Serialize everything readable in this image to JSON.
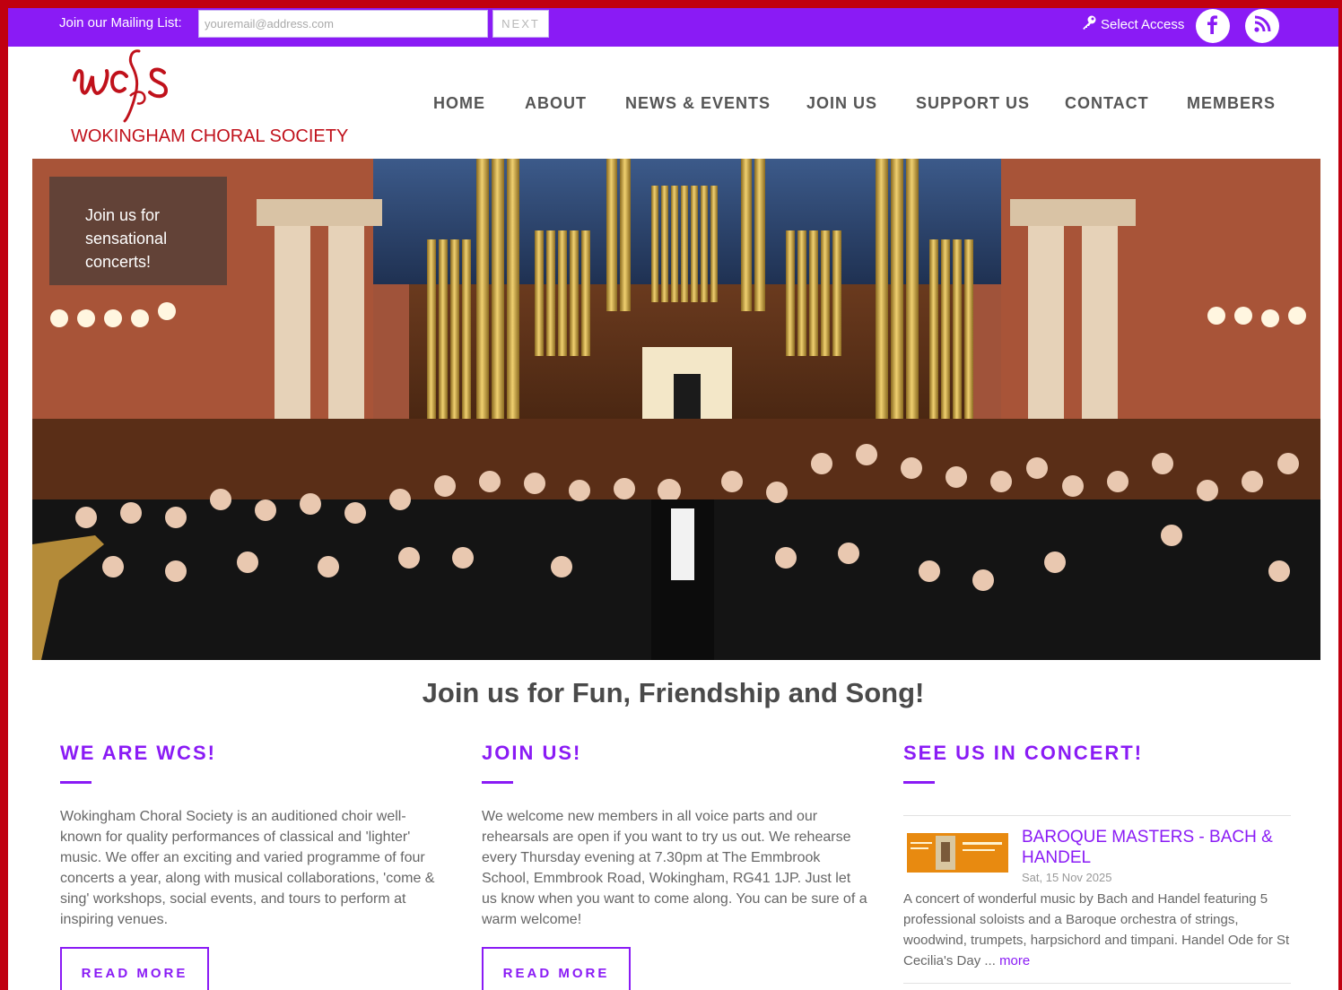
{
  "topbar": {
    "mailing_label": "Join our Mailing List:",
    "email_placeholder": "youremail@address.com",
    "next_label": "NEXT",
    "access_label": "Select Access"
  },
  "logo": {
    "mark": "wcs",
    "name": "WOKINGHAM CHORAL SOCIETY"
  },
  "nav": [
    {
      "label": "HOME"
    },
    {
      "label": "ABOUT"
    },
    {
      "label": "NEWS & EVENTS"
    },
    {
      "label": "JOIN US"
    },
    {
      "label": "SUPPORT US"
    },
    {
      "label": "CONTACT"
    },
    {
      "label": "MEMBERS"
    }
  ],
  "hero": {
    "caption": "Join us for sensational concerts!"
  },
  "tagline": "Join us for Fun, Friendship and Song!",
  "columns": [
    {
      "title": "WE ARE WCS!",
      "body": "Wokingham Choral Society is an auditioned choir well-known for quality performances of classical and 'lighter' music. We offer an exciting and varied programme of four concerts a year, along with musical collaborations, 'come & sing' workshops, social events, and tours to perform at inspiring venues.",
      "button": "READ MORE"
    },
    {
      "title": "JOIN US!",
      "body": "We welcome new members in all voice parts and our rehearsals are open if you want to try us out. We rehearse every Thursday evening at 7.30pm at The Emmbrook School, Emmbrook Road, Wokingham, RG41 1JP.  Just let us know when you want to come along. You can be sure of a warm welcome!",
      "button": "READ MORE"
    },
    {
      "title": "SEE US IN CONCERT!"
    }
  ],
  "event": {
    "title": "BAROQUE MASTERS - BACH & HANDEL",
    "date": "Sat, 15 Nov 2025",
    "description": "A concert of wonderful music by Bach and Handel featuring 5 professional soloists and a Baroque orchestra of strings, woodwind, trumpets, harpsichord and timpani. Handel Ode for St Cecilia's Day ...",
    "more": "more"
  },
  "colors": {
    "accent": "#8a1bf5",
    "brand_red": "#c0111b",
    "frame_red": "#c00010"
  },
  "icons": {
    "access": "key-icon",
    "facebook": "facebook-icon",
    "rss": "rss-icon"
  }
}
